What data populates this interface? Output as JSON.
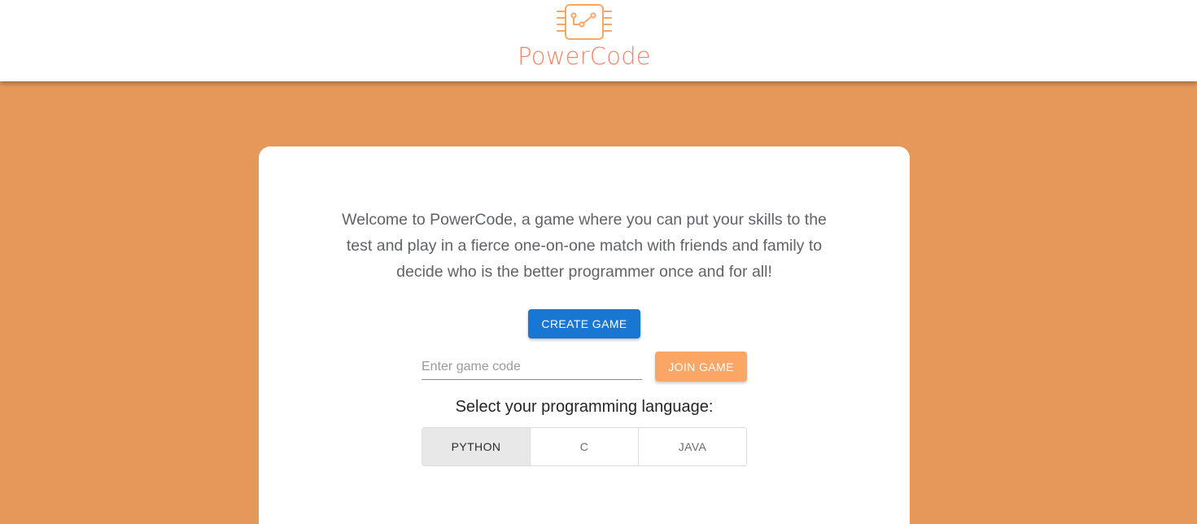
{
  "brand": {
    "name": "PowerCode",
    "icon": "circuit-chip-icon",
    "color": "#F0856A",
    "icon_color": "#FBA664"
  },
  "colors": {
    "background": "#E59859",
    "primary": "#1976D2",
    "secondary": "#FBA664"
  },
  "welcome": {
    "line1": "Welcome to PowerCode, a game where you can put your skills to the",
    "line2": "test and play in a fierce one-on-one match with friends and family to",
    "line3": "decide who is the better programmer once and for all!"
  },
  "actions": {
    "create_label": "CREATE GAME",
    "join_label": "JOIN GAME",
    "code_placeholder": "Enter game code",
    "code_value": ""
  },
  "language": {
    "prompt": "Select your programming language:",
    "options": [
      "PYTHON",
      "C",
      "JAVA"
    ],
    "selected": "PYTHON"
  }
}
